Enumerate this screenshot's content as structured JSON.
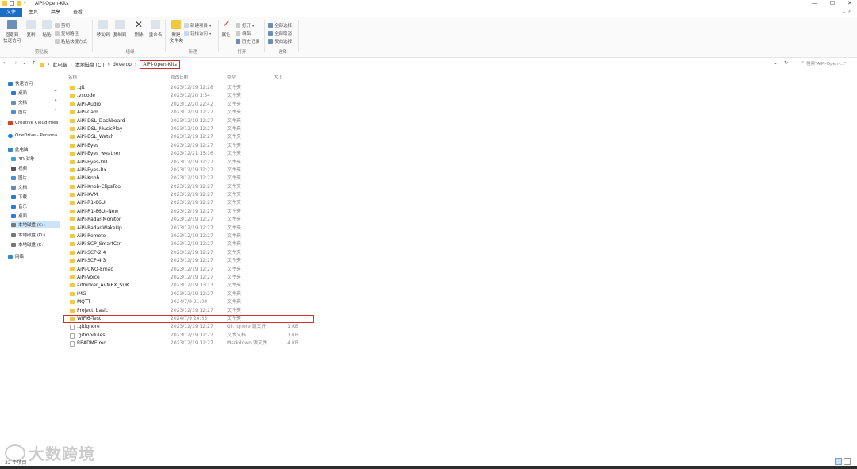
{
  "window": {
    "title": "AiPi-Open-Kits",
    "controls": [
      "—",
      "☐",
      "✕"
    ]
  },
  "tabs": [
    "文件",
    "主页",
    "共享",
    "查看"
  ],
  "ribbon": {
    "clipboard": {
      "label": "剪贴板",
      "pin": "固定到\n快速访问",
      "copy": "复制",
      "paste": "粘贴",
      "cut": "剪切",
      "copy_path": "复制路径",
      "paste_shortcut": "粘贴快捷方式"
    },
    "organize": {
      "label": "组织",
      "move_to": "移动到",
      "copy_to": "复制到",
      "delete": "删除",
      "rename": "重命名"
    },
    "new": {
      "label": "新建",
      "new_folder": "新建\n文件夹",
      "new_item": "新建项目 ▾",
      "easy_access": "轻松访问 ▾"
    },
    "open": {
      "label": "打开",
      "properties": "属性",
      "open": "打开 ▾",
      "edit": "编辑",
      "history": "历史记录"
    },
    "select": {
      "label": "选择",
      "select_all": "全部选择",
      "select_none": "全部取消",
      "invert": "反向选择"
    }
  },
  "address": {
    "crumbs": [
      "此电脑",
      "本地磁盘 (C:)",
      "develop"
    ],
    "current": "AiPi-Open-Kits",
    "search_placeholder": "搜索\"AiPi-Open-...\""
  },
  "nav": [
    {
      "label": "快速访问",
      "color": "#2b7cd3"
    },
    {
      "label": "桌面",
      "color": "#2b7cd3"
    },
    {
      "label": "文档",
      "color": "#6a8bb5"
    },
    {
      "label": "图片",
      "color": "#4a8fd6"
    },
    {
      "label": "Creative Cloud Files",
      "color": "#d9411e"
    },
    {
      "label": "OneDrive - Persona",
      "color": "#1c7ed6"
    },
    {
      "label": "此电脑",
      "color": "#3a86c8"
    },
    {
      "label": "3D 对象",
      "color": "#3aa0d8"
    },
    {
      "label": "视频",
      "color": "#555"
    },
    {
      "label": "图片",
      "color": "#4a8fd6"
    },
    {
      "label": "文档",
      "color": "#6a8bb5"
    },
    {
      "label": "下载",
      "color": "#2b7cd3"
    },
    {
      "label": "音乐",
      "color": "#2b7cd3"
    },
    {
      "label": "桌面",
      "color": "#2b7cd3"
    },
    {
      "label": "本地磁盘 (C:)",
      "color": "#777"
    },
    {
      "label": "本地磁盘 (D:)",
      "color": "#777"
    },
    {
      "label": "本地磁盘 (E:)",
      "color": "#777"
    },
    {
      "label": "网络",
      "color": "#3a86c8"
    }
  ],
  "columns": {
    "name": "名称",
    "date": "修改日期",
    "type": "类型",
    "size": "大小"
  },
  "files": [
    {
      "name": ".git",
      "date": "2023/12/19 12:28",
      "type": "文件夹",
      "size": ""
    },
    {
      "name": ".vscode",
      "date": "2023/12/20 1:54",
      "type": "文件夹",
      "size": ""
    },
    {
      "name": "AiPi-Audio",
      "date": "2023/12/20 22:42",
      "type": "文件夹",
      "size": ""
    },
    {
      "name": "AiPi-Cam",
      "date": "2023/12/19 12:27",
      "type": "文件夹",
      "size": ""
    },
    {
      "name": "AiPi-DSL_Dashboard",
      "date": "2023/12/19 12:27",
      "type": "文件夹",
      "size": ""
    },
    {
      "name": "AiPi-DSL_MusicPlay",
      "date": "2023/12/19 12:27",
      "type": "文件夹",
      "size": ""
    },
    {
      "name": "AiPi-DSL_Watch",
      "date": "2023/12/19 12:27",
      "type": "文件夹",
      "size": ""
    },
    {
      "name": "AiPi-Eyes",
      "date": "2023/12/19 12:27",
      "type": "文件夹",
      "size": ""
    },
    {
      "name": "AiPi-Eyes_weather",
      "date": "2023/12/21 15:16",
      "type": "文件夹",
      "size": ""
    },
    {
      "name": "AiPi-Eyes-DU",
      "date": "2023/12/19 12:27",
      "type": "文件夹",
      "size": ""
    },
    {
      "name": "AiPi-Eyes-Rx",
      "date": "2023/12/19 12:27",
      "type": "文件夹",
      "size": ""
    },
    {
      "name": "AiPi-Knob",
      "date": "2023/12/19 12:27",
      "type": "文件夹",
      "size": ""
    },
    {
      "name": "AiPi-Knob-ClipsTool",
      "date": "2023/12/19 12:27",
      "type": "文件夹",
      "size": ""
    },
    {
      "name": "AiPi-KVM",
      "date": "2023/12/19 12:27",
      "type": "文件夹",
      "size": ""
    },
    {
      "name": "AiPi-R1-86UI",
      "date": "2023/12/19 12:27",
      "type": "文件夹",
      "size": ""
    },
    {
      "name": "AiPi-R1-86UI-New",
      "date": "2023/12/19 12:27",
      "type": "文件夹",
      "size": ""
    },
    {
      "name": "AiPi-Radar-Monitor",
      "date": "2023/12/19 12:27",
      "type": "文件夹",
      "size": ""
    },
    {
      "name": "AiPi-Radar-WakeUp",
      "date": "2023/12/19 12:27",
      "type": "文件夹",
      "size": ""
    },
    {
      "name": "AiPi-Remote",
      "date": "2023/12/19 12:27",
      "type": "文件夹",
      "size": ""
    },
    {
      "name": "AiPi-SCP_SmartCtrl",
      "date": "2023/12/19 12:27",
      "type": "文件夹",
      "size": ""
    },
    {
      "name": "AiPi-SCP-2.4",
      "date": "2023/12/19 12:27",
      "type": "文件夹",
      "size": ""
    },
    {
      "name": "AiPi-SCP-4.3",
      "date": "2023/12/19 12:27",
      "type": "文件夹",
      "size": ""
    },
    {
      "name": "AiPi-UNO-Emac",
      "date": "2023/12/19 12:27",
      "type": "文件夹",
      "size": ""
    },
    {
      "name": "AiPi-Voice",
      "date": "2023/12/19 12:27",
      "type": "文件夹",
      "size": ""
    },
    {
      "name": "aithinker_Ai-M6X_SDK",
      "date": "2023/12/19 13:13",
      "type": "文件夹",
      "size": ""
    },
    {
      "name": "IMG",
      "date": "2023/12/19 12:27",
      "type": "文件夹",
      "size": ""
    },
    {
      "name": "MQTT",
      "date": "2024/7/9 21:00",
      "type": "文件夹",
      "size": ""
    },
    {
      "name": "Project_basic",
      "date": "2023/12/19 12:27",
      "type": "文件夹",
      "size": ""
    },
    {
      "name": "WIFI6-Test",
      "date": "2024/7/9 20:35",
      "type": "文件夹",
      "size": ""
    },
    {
      "name": ".gitignore",
      "date": "2023/12/19 12:27",
      "type": "Git Ignore 源文件",
      "size": "1 KB"
    },
    {
      "name": ".gitmodules",
      "date": "2023/12/19 12:27",
      "type": "文本文档",
      "size": "1 KB"
    },
    {
      "name": "README.md",
      "date": "2023/12/19 12:27",
      "type": "Markdown 源文件",
      "size": "4 KB"
    }
  ],
  "status": "32 个项目",
  "watermark": "大数跨境",
  "colors": {
    "accent": "#1a6fc4",
    "highlight": "#d62e2e",
    "folder": "#f2c744",
    "selected": "#cce4f7"
  }
}
